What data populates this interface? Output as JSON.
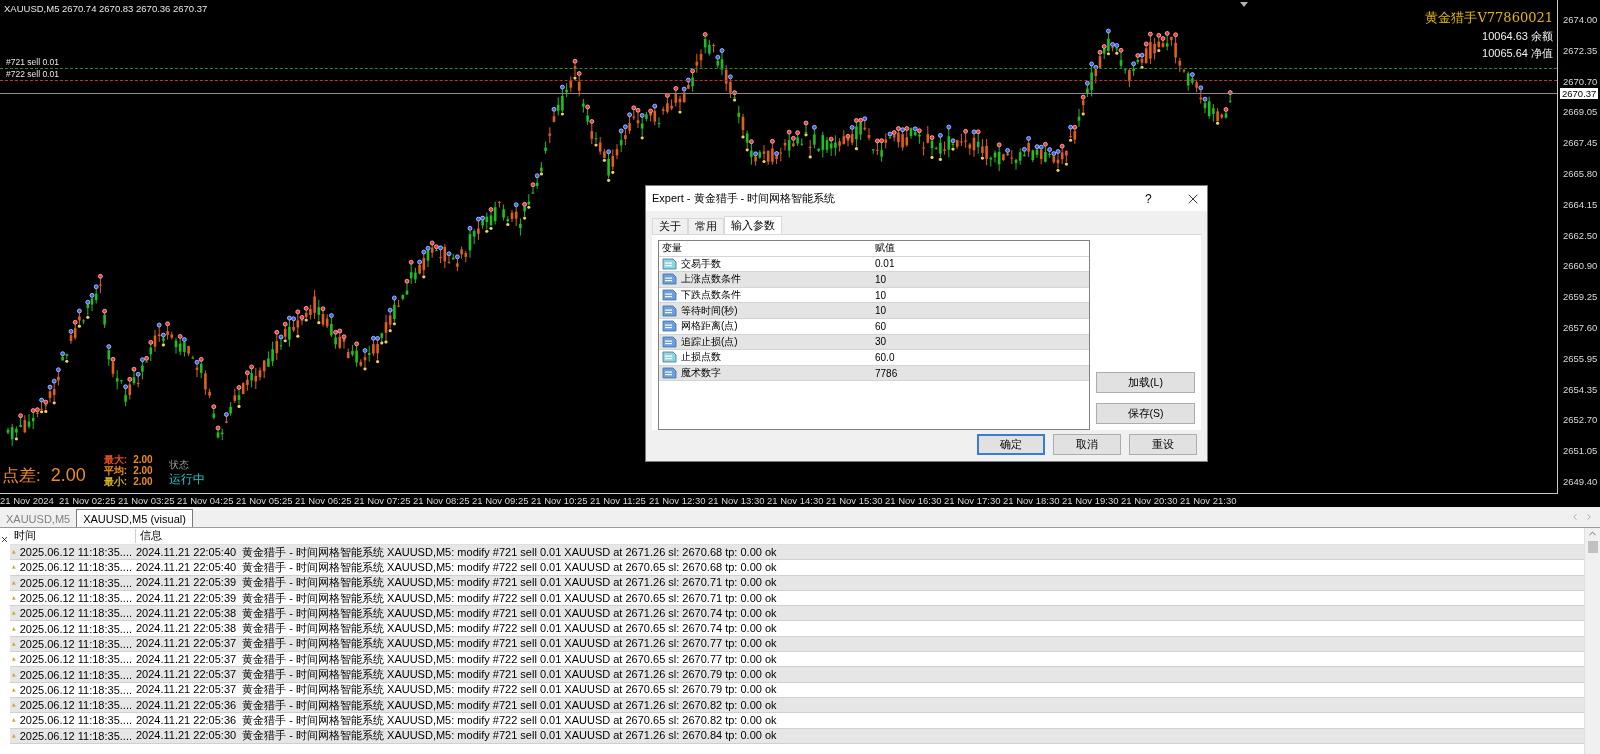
{
  "chart": {
    "header": {
      "symbol": "XAUUSD,M5",
      "quote": "2670.74 2670.83 2670.36 2670.37"
    },
    "orders": [
      {
        "label": "#721 sell 0.01",
        "color": "#2e8b2e"
      },
      {
        "label": "#722 sell 0.01",
        "color": "#c83232"
      }
    ],
    "current_price": "2670.37",
    "price_ticks": [
      "2674.00",
      "2672.35",
      "2670.70",
      "2669.05",
      "2667.45",
      "2665.80",
      "2664.15",
      "2662.50",
      "2660.90",
      "2659.25",
      "2657.60",
      "2655.95",
      "2654.35",
      "2652.70",
      "2651.05",
      "2649.40"
    ],
    "time_ticks": [
      "21 Nov 2024",
      "21 Nov 02:25",
      "21 Nov 03:25",
      "21 Nov 04:25",
      "21 Nov 05:25",
      "21 Nov 06:25",
      "21 Nov 07:25",
      "21 Nov 08:25",
      "21 Nov 09:25",
      "21 Nov 10:25",
      "21 Nov 11:25",
      "21 Nov 12:30",
      "21 Nov 13:30",
      "21 Nov 14:30",
      "21 Nov 15:30",
      "21 Nov 16:30",
      "21 Nov 17:30",
      "21 Nov 18:30",
      "21 Nov 19:30",
      "21 Nov 20:30",
      "21 Nov 21:30"
    ],
    "panel": {
      "title": "黄金猎手V77860021",
      "lines": [
        "10064.63 余额",
        "10065.64 净值"
      ]
    },
    "spread": {
      "label": "点差:",
      "value": "2.00",
      "stats": [
        {
          "label": "最大:",
          "value": "2.00",
          "color": "#e0501e"
        },
        {
          "label": "平均:",
          "value": "2.00",
          "color": "#f08c1e"
        },
        {
          "label": "最小:",
          "value": "2.00",
          "color": "#d2b41e"
        }
      ],
      "status_label": "状态",
      "status": "运行中"
    }
  },
  "dialog": {
    "title": "Expert - 黄金猎手 - 时间网格智能系统",
    "help": "?",
    "tabs": [
      {
        "label": "关于",
        "selected": false
      },
      {
        "label": "常用",
        "selected": false
      },
      {
        "label": "输入参数",
        "selected": true
      }
    ],
    "columns": [
      "变量",
      "赋值"
    ],
    "rows": [
      {
        "kind": "double",
        "name": "交易手数",
        "value": "0.01"
      },
      {
        "kind": "int",
        "name": "上涨点数条件",
        "value": "10"
      },
      {
        "kind": "int",
        "name": "下跌点数条件",
        "value": "10"
      },
      {
        "kind": "int",
        "name": "等待时间(秒)",
        "value": "10"
      },
      {
        "kind": "int",
        "name": "网格距离(点)",
        "value": "60"
      },
      {
        "kind": "int",
        "name": "追踪止损(点)",
        "value": "30"
      },
      {
        "kind": "double",
        "name": "止损点数",
        "value": "60.0"
      },
      {
        "kind": "int",
        "name": "魔术数字",
        "value": "7786"
      }
    ],
    "side_buttons": [
      "加载(L)",
      "保存(S)"
    ],
    "buttons": [
      {
        "label": "确定",
        "default": true
      },
      {
        "label": "取消",
        "default": false
      },
      {
        "label": "重设",
        "default": false
      }
    ]
  },
  "chart_tabs": [
    {
      "label": "XAUUSD,M5",
      "selected": false
    },
    {
      "label": "XAUUSD,M5 (visual)",
      "selected": true
    }
  ],
  "journal": {
    "columns": [
      "时间",
      "信息"
    ],
    "rows": [
      {
        "time": "2025.06.12 11:18:35....",
        "message": "2024.11.21 22:05:40  黄金猎手 - 时间网格智能系统 XAUUSD,M5: modify #721 sell 0.01 XAUUSD at 2671.26 sl: 2670.68 tp: 0.00 ok"
      },
      {
        "time": "2025.06.12 11:18:35....",
        "message": "2024.11.21 22:05:40  黄金猎手 - 时间网格智能系统 XAUUSD,M5: modify #722 sell 0.01 XAUUSD at 2670.65 sl: 2670.68 tp: 0.00 ok"
      },
      {
        "time": "2025.06.12 11:18:35....",
        "message": "2024.11.21 22:05:39  黄金猎手 - 时间网格智能系统 XAUUSD,M5: modify #721 sell 0.01 XAUUSD at 2671.26 sl: 2670.71 tp: 0.00 ok"
      },
      {
        "time": "2025.06.12 11:18:35....",
        "message": "2024.11.21 22:05:39  黄金猎手 - 时间网格智能系统 XAUUSD,M5: modify #722 sell 0.01 XAUUSD at 2670.65 sl: 2670.71 tp: 0.00 ok"
      },
      {
        "time": "2025.06.12 11:18:35....",
        "message": "2024.11.21 22:05:38  黄金猎手 - 时间网格智能系统 XAUUSD,M5: modify #721 sell 0.01 XAUUSD at 2671.26 sl: 2670.74 tp: 0.00 ok"
      },
      {
        "time": "2025.06.12 11:18:35....",
        "message": "2024.11.21 22:05:38  黄金猎手 - 时间网格智能系统 XAUUSD,M5: modify #722 sell 0.01 XAUUSD at 2670.65 sl: 2670.74 tp: 0.00 ok"
      },
      {
        "time": "2025.06.12 11:18:35....",
        "message": "2024.11.21 22:05:37  黄金猎手 - 时间网格智能系统 XAUUSD,M5: modify #721 sell 0.01 XAUUSD at 2671.26 sl: 2670.77 tp: 0.00 ok"
      },
      {
        "time": "2025.06.12 11:18:35....",
        "message": "2024.11.21 22:05:37  黄金猎手 - 时间网格智能系统 XAUUSD,M5: modify #722 sell 0.01 XAUUSD at 2670.65 sl: 2670.77 tp: 0.00 ok"
      },
      {
        "time": "2025.06.12 11:18:35....",
        "message": "2024.11.21 22:05:37  黄金猎手 - 时间网格智能系统 XAUUSD,M5: modify #721 sell 0.01 XAUUSD at 2671.26 sl: 2670.79 tp: 0.00 ok"
      },
      {
        "time": "2025.06.12 11:18:35....",
        "message": "2024.11.21 22:05:37  黄金猎手 - 时间网格智能系统 XAUUSD,M5: modify #722 sell 0.01 XAUUSD at 2670.65 sl: 2670.79 tp: 0.00 ok"
      },
      {
        "time": "2025.06.12 11:18:35....",
        "message": "2024.11.21 22:05:36  黄金猎手 - 时间网格智能系统 XAUUSD,M5: modify #721 sell 0.01 XAUUSD at 2671.26 sl: 2670.82 tp: 0.00 ok"
      },
      {
        "time": "2025.06.12 11:18:35....",
        "message": "2024.11.21 22:05:36  黄金猎手 - 时间网格智能系统 XAUUSD,M5: modify #722 sell 0.01 XAUUSD at 2670.65 sl: 2670.82 tp: 0.00 ok"
      },
      {
        "time": "2025.06.12 11:18:35....",
        "message": "2024.11.21 22:05:30  黄金猎手 - 时间网格智能系统 XAUUSD,M5: modify #721 sell 0.01 XAUUSD at 2671.26 sl: 2670.84 tp: 0.00 ok"
      }
    ]
  }
}
